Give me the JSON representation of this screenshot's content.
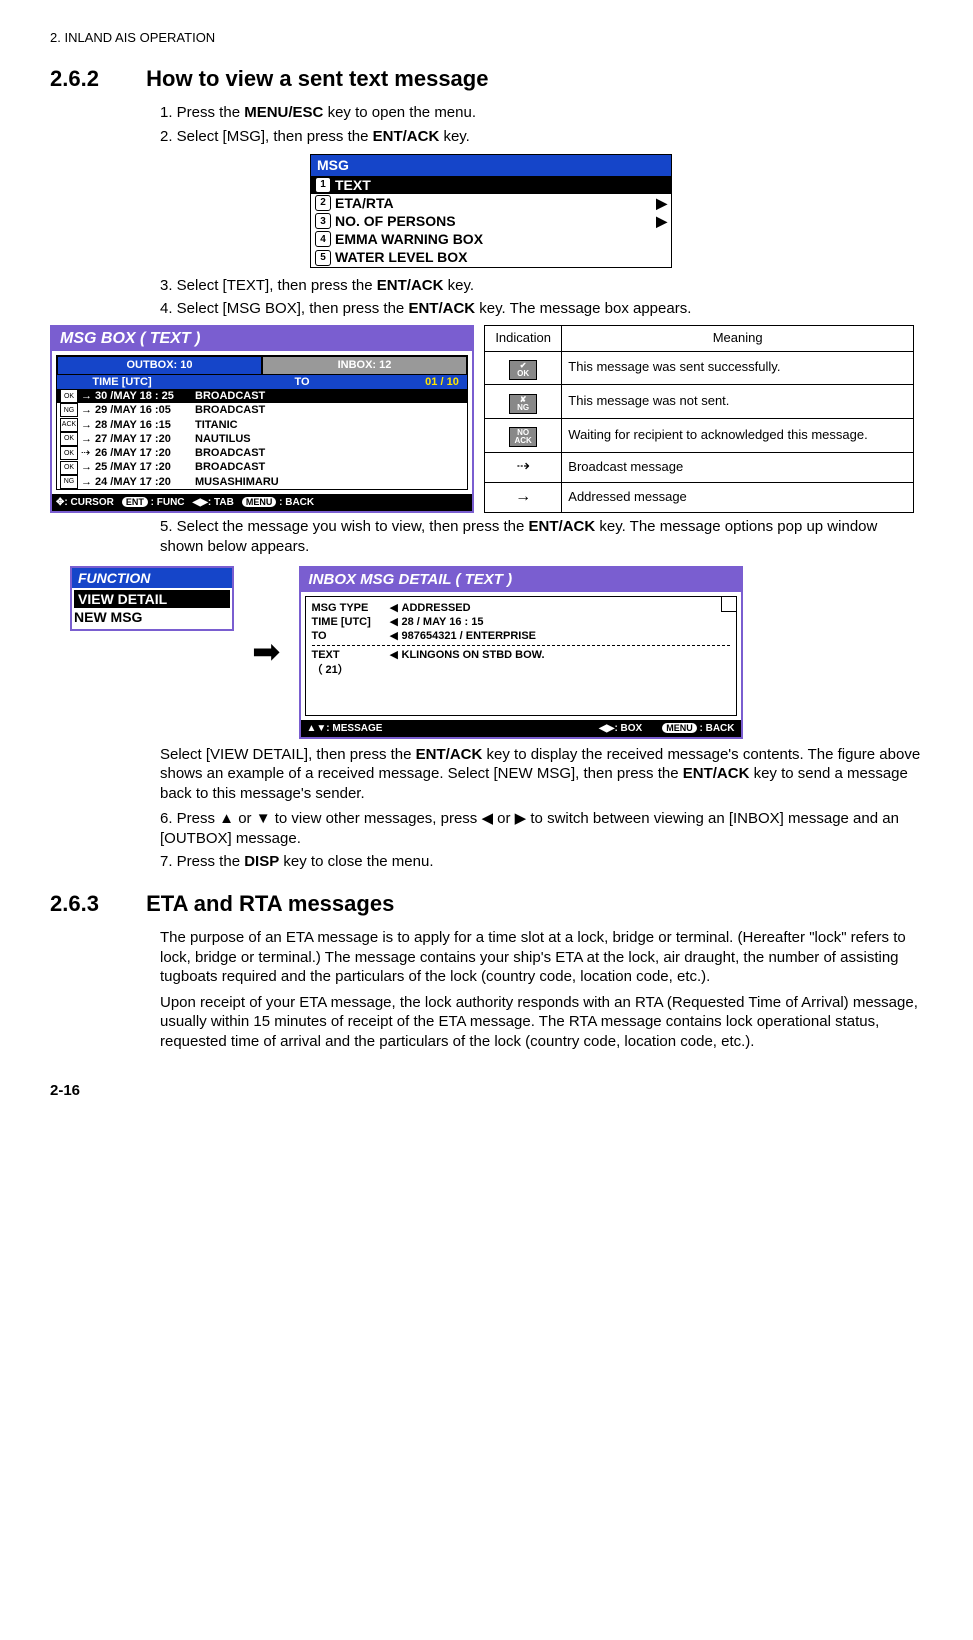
{
  "header": {
    "chapter": "2.  INLAND AIS OPERATION"
  },
  "section1": {
    "num": "2.6.2",
    "title": "How to view a sent text message",
    "step1_pre": "1.   Press the ",
    "step1_bold": "MENU/ESC",
    "step1_post": " key to open the menu.",
    "step2_pre": "2.   Select [MSG], then press the ",
    "step2_bold": "ENT/ACK",
    "step2_post": " key.",
    "step3_pre": "3.   Select [TEXT], then press the ",
    "step3_bold": "ENT/ACK",
    "step3_post": " key.",
    "step4_pre": "4.   Select [MSG BOX], then press the ",
    "step4_bold": "ENT/ACK",
    "step4_post": " key. The message box appears.",
    "step5_pre": "5.   Select the message you wish to view, then press the ",
    "step5_bold": "ENT/ACK",
    "step5_post": " key. The message options pop up window shown below appears.",
    "para1a": "Select [VIEW DETAIL], then press the ",
    "para1b": "ENT/ACK",
    "para1c": " key to display the received message's contents. The figure above shows an example of a received message. Select [NEW MSG], then press the ",
    "para1d": "ENT/ACK",
    "para1e": " key to send a message back to this message's sender.",
    "step6": "6.   Press ▲ or ▼ to view other messages, press ◀ or ▶ to switch between viewing an [INBOX] message and an [OUTBOX] message.",
    "step7_pre": "7.   Press the ",
    "step7_bold": "DISP",
    "step7_post": " key to close the menu."
  },
  "msgmenu": {
    "title": "MSG",
    "items": [
      {
        "n": "1",
        "label": "TEXT",
        "sel": true,
        "arrow": false
      },
      {
        "n": "2",
        "label": "ETA/RTA",
        "sel": false,
        "arrow": true
      },
      {
        "n": "3",
        "label": "NO. OF PERSONS",
        "sel": false,
        "arrow": true
      },
      {
        "n": "4",
        "label": "EMMA WARNING BOX",
        "sel": false,
        "arrow": false
      },
      {
        "n": "5",
        "label": "WATER LEVEL BOX",
        "sel": false,
        "arrow": false
      }
    ]
  },
  "msgbox": {
    "title": "MSG  BOX   ( TEXT )",
    "tab1": "OUTBOX: 10",
    "tab2": "INBOX: 12",
    "h_time": "TIME [UTC]",
    "h_to": "TO",
    "h_page": "01 / 10",
    "rows": [
      {
        "ico": "OK",
        "arr": "→",
        "dt": "30 /MAY   18 : 25",
        "to": "BROADCAST",
        "sel": true
      },
      {
        "ico": "NG",
        "arr": "→",
        "dt": "29 /MAY   16 :05",
        "to": "BROADCAST"
      },
      {
        "ico": "ACK",
        "arr": "→",
        "dt": "28 /MAY   16 :15",
        "to": "TITANIC"
      },
      {
        "ico": "OK",
        "arr": "→",
        "dt": "27 /MAY   17 :20",
        "to": "NAUTILUS"
      },
      {
        "ico": "OK",
        "arr": "⇢",
        "dt": "26 /MAY   17 :20",
        "to": "BROADCAST"
      },
      {
        "ico": "OK",
        "arr": "→",
        "dt": "25 /MAY   17 :20",
        "to": "BROADCAST"
      },
      {
        "ico": "NG",
        "arr": "→",
        "dt": "24 /MAY   17 :20",
        "to": "MUSASHIMARU"
      }
    ],
    "foot_cursor": ": CURSOR",
    "foot_func": ": FUNC",
    "foot_tab": ": TAB",
    "foot_back": ": BACK",
    "pill_ent": "ENT",
    "pill_menu": "MENU"
  },
  "indtable": {
    "h1": "Indication",
    "h2": "Meaning",
    "r1_ico": "✔ OK",
    "r1_txt": "This message was sent successfully.",
    "r2_ico": "✘ NG",
    "r2_txt": "This message was not sent.",
    "r3_ico": "NO ACK",
    "r3_txt": "Waiting for recipient to acknowledged this message.",
    "r4_ico": "⇢",
    "r4_txt": "Broadcast message",
    "r5_ico": "→",
    "r5_txt": "Addressed message"
  },
  "func": {
    "title": "FUNCTION",
    "i1": "VIEW DETAIL",
    "i2": "NEW MSG"
  },
  "detail": {
    "title": "INBOX MSG DETAIL ( TEXT )",
    "l_type": "MSG  TYPE",
    "v_type": "ADDRESSED",
    "l_time": "TIME [UTC]",
    "v_time": "28 / MAY    16 : 15",
    "l_to": "TO",
    "v_to": "987654321 / ENTERPRISE",
    "l_text": "TEXT",
    "v_text": "KLINGONS ON STBD BOW.",
    "sub": "（ 21）",
    "f_msg": ": MESSAGE",
    "f_box": ": BOX",
    "f_back": ": BACK",
    "pill_menu": "MENU"
  },
  "section2": {
    "num": "2.6.3",
    "title": "ETA and RTA messages",
    "p1": "The purpose of an ETA message is to apply for a time slot at a lock, bridge or terminal. (Hereafter \"lock\" refers to lock, bridge or terminal.) The message contains your ship's ETA at the lock, air draught, the number of assisting tugboats required and the particulars of the lock (country code, location code, etc.).",
    "p2": "Upon receipt of your ETA message, the lock authority responds with an RTA (Requested Time of Arrival) message, usually within 15 minutes of receipt of the ETA message. The RTA message contains lock operational status, requested time of arrival and the particulars of the lock (country code, location code, etc.)."
  },
  "pagefoot": "2-16"
}
